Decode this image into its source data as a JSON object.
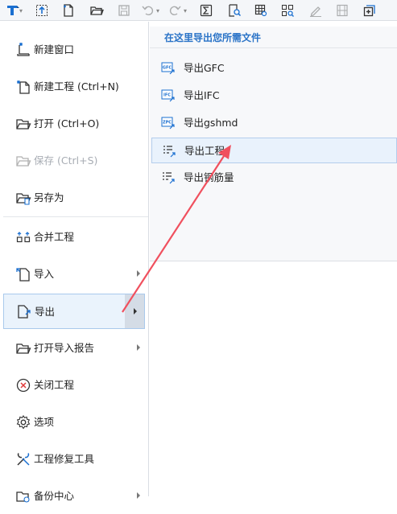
{
  "toolbar": {
    "icons": [
      "app-logo-icon",
      "select-icon",
      "new-file-icon",
      "open-folder-icon",
      "save-icon",
      "undo-icon",
      "redo-icon",
      "sum-icon",
      "find-icon",
      "table-icon",
      "quantity-search-icon",
      "edit-icon",
      "layout-icon",
      "add-icon"
    ]
  },
  "menu": {
    "items": [
      {
        "label": "新建窗口"
      },
      {
        "label": "新建工程 (Ctrl+N)"
      },
      {
        "label": "打开 (Ctrl+O)"
      },
      {
        "label": "保存 (Ctrl+S)"
      },
      {
        "label": "另存为"
      },
      {
        "label": "合并工程"
      },
      {
        "label": "导入"
      },
      {
        "label": "导出"
      },
      {
        "label": "打开导入报告"
      },
      {
        "label": "关闭工程"
      },
      {
        "label": "选项"
      },
      {
        "label": "工程修复工具"
      },
      {
        "label": "备份中心"
      }
    ]
  },
  "panel": {
    "title": "在这里导出您所需文件",
    "items": [
      {
        "label": "导出GFC",
        "badge": "GFC"
      },
      {
        "label": "导出IFC",
        "badge": "IFC"
      },
      {
        "label": "导出gshmd",
        "badge": "ZPC"
      },
      {
        "label": "导出工程"
      },
      {
        "label": "导出钢筋量"
      }
    ]
  },
  "colors": {
    "accent": "#2a73c7",
    "active_bg": "#eaf3fc",
    "arrow": "#f0505e"
  }
}
